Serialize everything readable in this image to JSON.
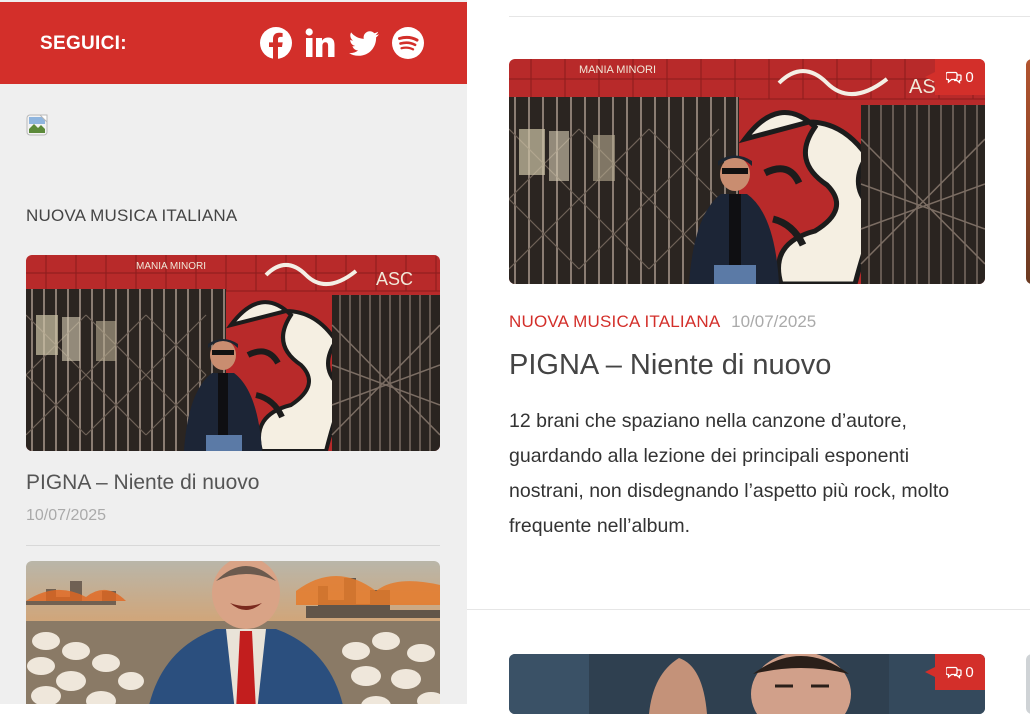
{
  "colors": {
    "accent": "#d32f2a",
    "sidebar_bg": "#efefef"
  },
  "sidebar": {
    "follow_label": "SEGUICI:",
    "social_icons": [
      "facebook-icon",
      "linkedin-icon",
      "twitter-icon",
      "spotify-icon"
    ],
    "widget_title": "NUOVA MUSICA ITALIANA",
    "posts": [
      {
        "title": "PIGNA – Niente di nuovo",
        "date": "10/07/2025"
      }
    ]
  },
  "main": {
    "posts": [
      {
        "comments": "0",
        "category": "NUOVA MUSICA ITALIANA",
        "date": "10/07/2025",
        "title": "PIGNA – Niente di nuovo",
        "excerpt": "12 brani che spaziano nella canzone d’autore, guardando alla lezione dei principali esponenti nostrani, non disdegnando l’aspetto più rock, molto frequente nell’album."
      },
      {
        "comments": "0"
      }
    ]
  }
}
